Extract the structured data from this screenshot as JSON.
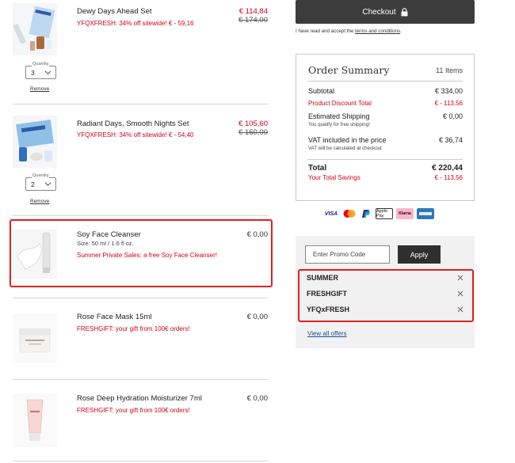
{
  "checkout": {
    "label": "Checkout",
    "icon": "lock-icon"
  },
  "terms": {
    "prefix": "I have read and accept the ",
    "link": "terms and conditions",
    "suffix": "."
  },
  "cart_items": [
    {
      "name": "Dewy Days Ahead Set",
      "promo": "YFQXFRESH: 34% off sitewide! € - 59,16",
      "price_now": "€ 114,84",
      "price_old": "€ 174,00",
      "quantity_label": "Quantity",
      "quantity": "3",
      "remove_label": "Remove"
    },
    {
      "name": "Radiant Days, Smooth Nights Set",
      "promo": "YFQXFRESH: 34% off sitewide! € - 54,40",
      "price_now": "€ 105,60",
      "price_old": "€ 160,00",
      "quantity_label": "Quantity",
      "quantity": "2",
      "remove_label": "Remove"
    },
    {
      "name": "Soy Face Cleanser",
      "size": "Size: 50 ml / 1.6 fl oz.",
      "promo": "Summer Private Sales: a free Soy Face Cleanser!",
      "price": "€ 0,00"
    },
    {
      "name": "Rose Face Mask 15ml",
      "promo": "FRESHGIFT: your gift from 100€ orders!",
      "price": "€ 0,00"
    },
    {
      "name": "Rose Deep Hydration Moisturizer 7ml",
      "promo": "FRESHGIFT: your gift from 100€ orders!",
      "price": "€ 0,00"
    }
  ],
  "summary": {
    "title": "Order Summary",
    "count": "11 Items",
    "subtotal_label": "Subtotal",
    "subtotal": "€ 334,00",
    "discount_label": "Product Discount Total",
    "discount": "€ - 113,56",
    "shipping_label": "Estimated Shipping",
    "shipping": "€ 0,00",
    "shipping_note": "You qualify for free shipping!",
    "vat_label": "VAT included in the price",
    "vat": "€ 36,74",
    "vat_note": "VAT will be calculated at checkout",
    "total_label": "Total",
    "total": "€ 220,44",
    "savings_label": "Your Total Savings",
    "savings": "€ - 113,56"
  },
  "payment_methods": [
    "VISA",
    "mastercard",
    "PayPal",
    "Apple Pay",
    "Klarna",
    "American Express"
  ],
  "promo": {
    "placeholder": "Enter Promo Code",
    "apply_label": "Apply",
    "codes": [
      "SUMMER",
      "FRESHGIFT",
      "YFQxFRESH"
    ],
    "all_offers_label": "View all offers"
  },
  "colors": {
    "accent_red": "#d0021b",
    "dark_button": "#3c3c3c",
    "highlight": "#e02020",
    "link_blue": "#1b4d91"
  }
}
